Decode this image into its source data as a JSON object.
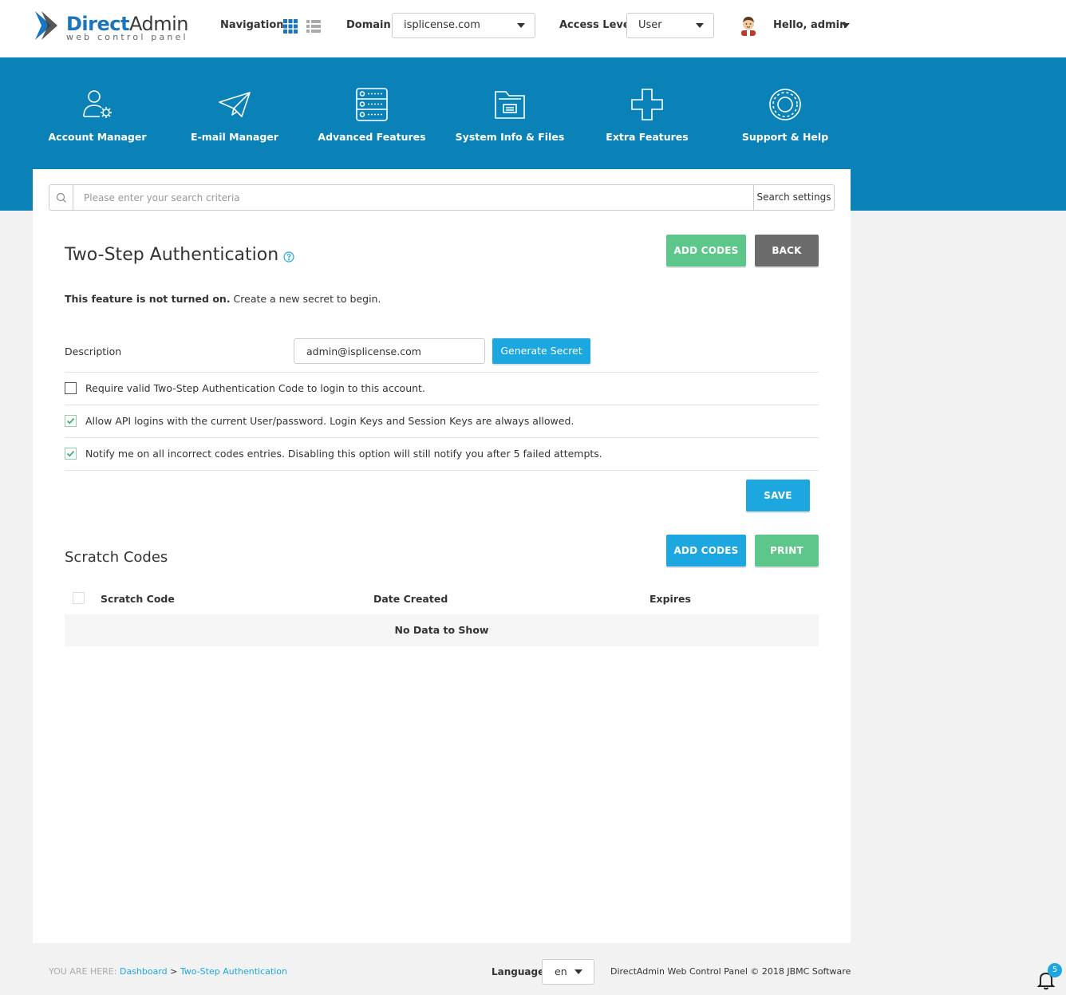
{
  "brand": {
    "name_part1": "Direct",
    "name_part2": "Admin",
    "subtitle": "web control panel"
  },
  "header": {
    "navigation_label": "Navigation",
    "domain_label": "Domain",
    "domain_value": "isplicense.com",
    "access_label": "Access Level",
    "access_value": "User",
    "greeting": "Hello, admin"
  },
  "nav": [
    {
      "label": "Account Manager",
      "icon": "account-manager-icon"
    },
    {
      "label": "E-mail Manager",
      "icon": "email-manager-icon"
    },
    {
      "label": "Advanced Features",
      "icon": "advanced-features-icon"
    },
    {
      "label": "System Info & Files",
      "icon": "system-info-icon"
    },
    {
      "label": "Extra Features",
      "icon": "extra-features-icon"
    },
    {
      "label": "Support & Help",
      "icon": "support-help-icon"
    }
  ],
  "search": {
    "placeholder": "Please enter your search criteria",
    "settings_label": "Search settings"
  },
  "page": {
    "title": "Two-Step Authentication",
    "add_codes_label": "ADD CODES",
    "back_label": "BACK",
    "notice_bold": "This feature is not turned on.",
    "notice_rest": " Create a new secret to begin.",
    "description_label": "Description",
    "description_value": "admin@isplicense.com",
    "generate_label": "Generate Secret",
    "options": [
      {
        "label": "Require valid Two-Step Authentication Code to login to this account.",
        "checked": false
      },
      {
        "label": "Allow API logins with the current User/password. Login Keys and Session Keys are always allowed.",
        "checked": true
      },
      {
        "label": "Notify me on all incorrect codes entries. Disabling this option will still notify you after 5 failed attempts.",
        "checked": true
      }
    ],
    "save_label": "SAVE"
  },
  "scratch": {
    "title": "Scratch Codes",
    "add_codes_label": "ADD CODES",
    "print_label": "PRINT",
    "columns": [
      "Scratch Code",
      "Date Created",
      "Expires"
    ],
    "empty_text": "No Data to Show"
  },
  "footer": {
    "you_are_here": "YOU ARE HERE:",
    "crumbs": [
      "Dashboard",
      "Two-Step Authentication"
    ],
    "crumb_sep": ">",
    "language_label": "Language",
    "language_value": "en",
    "copyright": "DirectAdmin Web Control Panel © 2018 JBMC Software",
    "notification_count": "5"
  },
  "colors": {
    "brand_blue": "#0b82b7",
    "accent_blue": "#1ca7e0",
    "accent_green": "#5dc68a",
    "back_gray": "#6b6b6b"
  }
}
